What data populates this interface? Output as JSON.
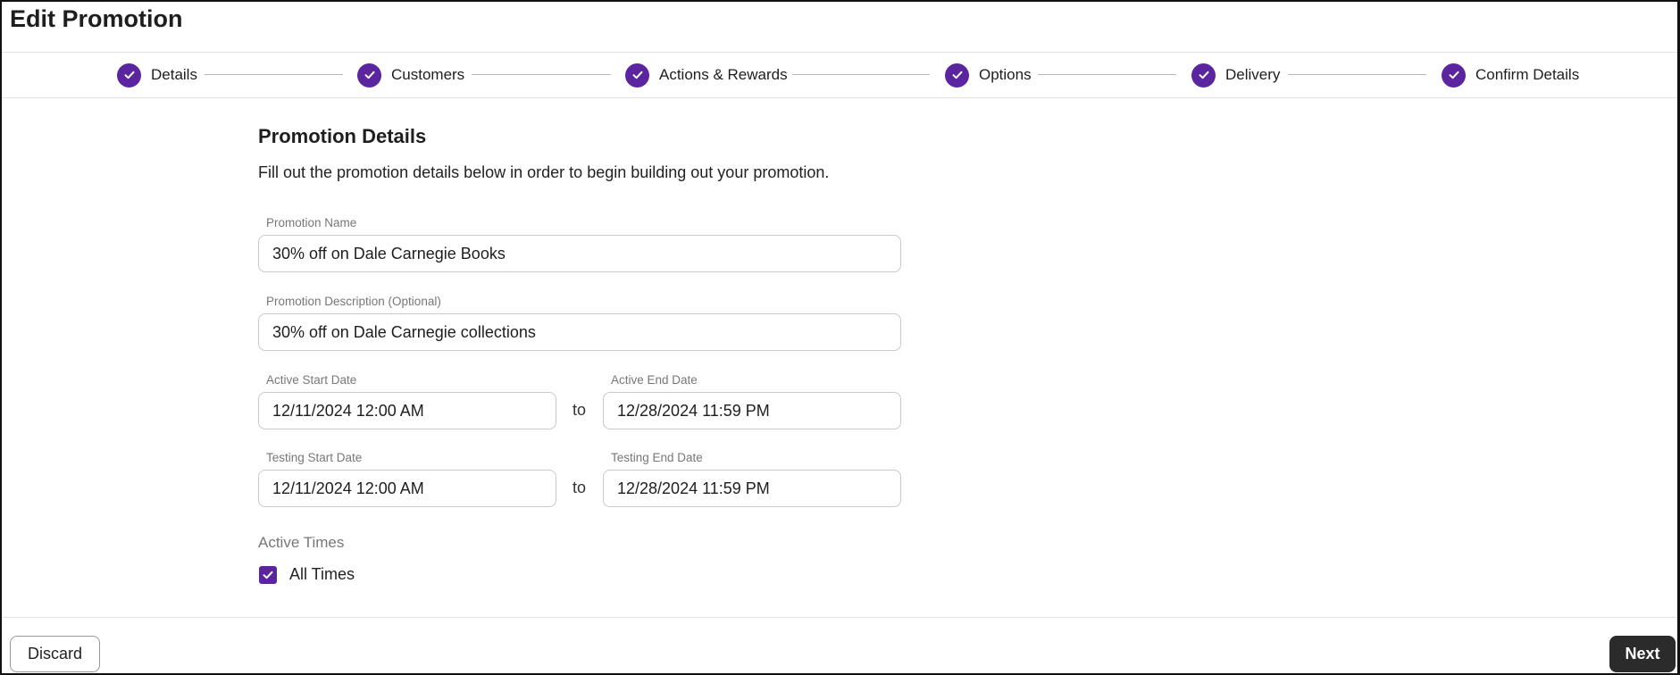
{
  "header": {
    "title": "Edit Promotion"
  },
  "stepper": {
    "steps": [
      {
        "label": "Details",
        "status": "complete",
        "icon": "check-icon"
      },
      {
        "label": "Customers",
        "status": "complete",
        "icon": "check-icon"
      },
      {
        "label": "Actions & Rewards",
        "status": "complete",
        "icon": "check-icon"
      },
      {
        "label": "Options",
        "status": "complete",
        "icon": "check-icon"
      },
      {
        "label": "Delivery",
        "status": "complete",
        "icon": "check-icon"
      },
      {
        "label": "Confirm Details",
        "status": "complete",
        "icon": "check-icon"
      }
    ],
    "accent_color": "#5b25a0"
  },
  "form": {
    "heading": "Promotion Details",
    "description": "Fill out the promotion details below in order to begin building out your promotion.",
    "promotion_name": {
      "label": "Promotion Name",
      "value": "30% off on Dale Carnegie Books"
    },
    "promotion_description": {
      "label": "Promotion Description (Optional)",
      "value": "30% off on Dale Carnegie collections"
    },
    "active_start": {
      "label": "Active Start Date",
      "value": "12/11/2024 12:00 AM"
    },
    "active_end": {
      "label": "Active End Date",
      "value": "12/28/2024 11:59 PM"
    },
    "testing_start": {
      "label": "Testing Start Date",
      "value": "12/11/2024 12:00 AM"
    },
    "testing_end": {
      "label": "Testing End Date",
      "value": "12/28/2024 11:59 PM"
    },
    "range_separator": "to",
    "active_times": {
      "label": "Active Times",
      "option_label": "All Times",
      "checked": true
    }
  },
  "footer": {
    "discard_label": "Discard",
    "next_label": "Next"
  }
}
